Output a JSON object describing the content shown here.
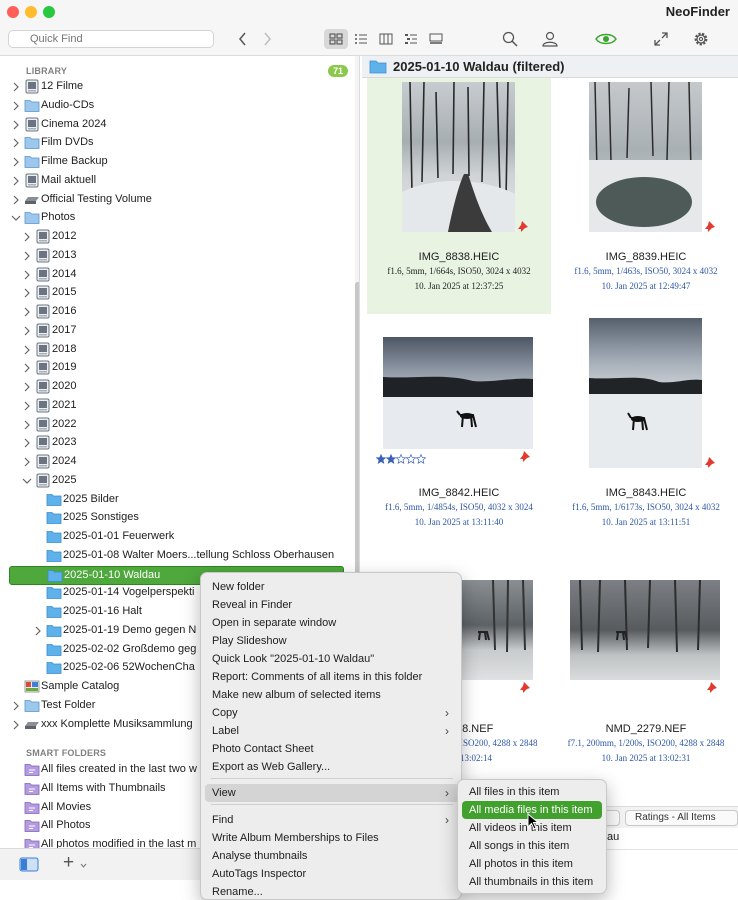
{
  "app_title": "NeoFinder",
  "search": {
    "placeholder": "Quick Find"
  },
  "sidebar": {
    "library_label": "LIBRARY",
    "library_count": "71",
    "library_items": [
      {
        "label": "12 Filme",
        "icon": "hard-drive-icon"
      },
      {
        "label": "Audio-CDs",
        "icon": "folder-icon"
      },
      {
        "label": "Cinema 2024",
        "icon": "hard-drive-icon"
      },
      {
        "label": "Film DVDs",
        "icon": "folder-icon"
      },
      {
        "label": "Filme Backup",
        "icon": "folder-icon"
      },
      {
        "label": "Mail aktuell",
        "icon": "hard-drive-icon"
      },
      {
        "label": "Official Testing Volume",
        "icon": "external-drive-icon"
      },
      {
        "label": "Photos",
        "icon": "folder-icon"
      },
      {
        "label": "2012",
        "icon": "hard-drive-icon"
      },
      {
        "label": "2013",
        "icon": "hard-drive-icon"
      },
      {
        "label": "2014",
        "icon": "hard-drive-icon"
      },
      {
        "label": "2015",
        "icon": "hard-drive-icon"
      },
      {
        "label": "2016",
        "icon": "hard-drive-icon"
      },
      {
        "label": "2017",
        "icon": "hard-drive-icon"
      },
      {
        "label": "2018",
        "icon": "hard-drive-icon"
      },
      {
        "label": "2019",
        "icon": "hard-drive-icon"
      },
      {
        "label": "2020",
        "icon": "hard-drive-icon"
      },
      {
        "label": "2021",
        "icon": "hard-drive-icon"
      },
      {
        "label": "2022",
        "icon": "hard-drive-icon"
      },
      {
        "label": "2023",
        "icon": "hard-drive-icon"
      },
      {
        "label": "2024",
        "icon": "hard-drive-icon"
      },
      {
        "label": "2025",
        "icon": "hard-drive-icon"
      },
      {
        "label": "2025 Bilder",
        "icon": "blue-folder-icon"
      },
      {
        "label": "2025 Sonstiges",
        "icon": "blue-folder-icon"
      },
      {
        "label": "2025-01-01 Feuerwerk",
        "icon": "blue-folder-icon"
      },
      {
        "label": "2025-01-08 Walter Moers...tellung Schloss Oberhausen",
        "icon": "blue-folder-icon"
      },
      {
        "label": "2025-01-10 Waldau",
        "icon": "blue-folder-icon"
      },
      {
        "label": "2025-01-14 Vogelperspekti",
        "icon": "blue-folder-icon"
      },
      {
        "label": "2025-01-16 Halt",
        "icon": "blue-folder-icon"
      },
      {
        "label": "2025-01-19 Demo gegen N",
        "icon": "blue-folder-icon"
      },
      {
        "label": "2025-02-02 Großdemo geg",
        "icon": "blue-folder-icon"
      },
      {
        "label": "2025-02-06 52WochenCha",
        "icon": "blue-folder-icon"
      },
      {
        "label": "Sample Catalog",
        "icon": "catalog-icon"
      },
      {
        "label": "Test Folder",
        "icon": "folder-icon"
      },
      {
        "label": "xxx Komplette Musiksammlung",
        "icon": "external-drive-icon"
      }
    ],
    "smart_label": "SMART FOLDERS",
    "smart_items": [
      {
        "label": "All files created in the last two w",
        "icon": "smart-folder-icon"
      },
      {
        "label": "All Items with Thumbnails",
        "icon": "smart-folder-icon"
      },
      {
        "label": "All Movies",
        "icon": "smart-folder-icon"
      },
      {
        "label": "All Photos",
        "icon": "smart-folder-icon"
      },
      {
        "label": "All photos modified in the last m",
        "icon": "smart-folder-icon"
      }
    ],
    "add_label": "+"
  },
  "main": {
    "folder_title": "2025-01-10 Waldau  (filtered)",
    "photos": [
      {
        "filename": "IMG_8838.HEIC",
        "info": "f1.6, 5mm, 1/664s, ISO50, 3024 x 4032",
        "date": "10. Jan 2025 at 12:37:25",
        "rating": 0
      },
      {
        "filename": "IMG_8839.HEIC",
        "info": "f1.6, 5mm, 1/463s, ISO50, 3024 x 4032",
        "date": "10. Jan 2025 at 12:49:47",
        "rating": 0
      },
      {
        "filename": "IMG_8842.HEIC",
        "info": "f1.6, 5mm, 1/4854s, ISO50, 4032 x 3024",
        "date": "10. Jan 2025 at 13:11:40",
        "rating": 2
      },
      {
        "filename": "IMG_8843.HEIC",
        "info": "f1.6, 5mm, 1/6173s, ISO50, 3024 x 4032",
        "date": "10. Jan 2025 at 13:11:51",
        "rating": 0
      },
      {
        "filename": "78.NEF",
        "info": "ISO200, 4288 x 2848",
        "date": "13:02:14",
        "rating": 0
      },
      {
        "filename": "NMD_2279.NEF",
        "info": "f7.1, 200mm, 1/200s, ISO200, 4288 x 2848",
        "date": "10. Jan 2025 at 13:02:31",
        "rating": 0
      }
    ],
    "ratings_filter": "Ratings - All Items",
    "partial_label": "au"
  },
  "context_menu": {
    "items": [
      {
        "label": "New folder",
        "submenu": false
      },
      {
        "label": "Reveal in Finder",
        "submenu": false
      },
      {
        "label": "Open in separate window",
        "submenu": false
      },
      {
        "label": "Play Slideshow",
        "submenu": false
      },
      {
        "label": "Quick Look \"2025-01-10 Waldau\"",
        "submenu": false
      },
      {
        "label": "Report: Comments of all items in this folder",
        "submenu": false
      },
      {
        "label": "Make new album of selected items",
        "submenu": false
      },
      {
        "label": "Copy",
        "submenu": true
      },
      {
        "label": "Label",
        "submenu": true
      },
      {
        "label": "Photo Contact Sheet",
        "submenu": false
      },
      {
        "label": "Export as Web Gallery...",
        "submenu": false
      },
      {
        "label": "View",
        "submenu": true
      },
      {
        "label": "Find",
        "submenu": true
      },
      {
        "label": "Write Album Memberships to Files",
        "submenu": false
      },
      {
        "label": "Analyse thumbnails",
        "submenu": false
      },
      {
        "label": "AutoTags Inspector",
        "submenu": false
      },
      {
        "label": "Rename...",
        "submenu": false
      }
    ],
    "highlighted": "View"
  },
  "view_submenu": {
    "items": [
      "All files in this item",
      "All media files in this item",
      "All videos in this item",
      "All songs in this item",
      "All photos in this item",
      "All thumbnails in this item"
    ],
    "selected": "All media files in this item"
  },
  "colors": {
    "selection_green": "#4ea83c",
    "menu_highlight_green": "#41a02e",
    "selected_cell": "#e8f3e2",
    "meta_blue": "#2d57a8",
    "badge_green": "#8cc84b"
  }
}
